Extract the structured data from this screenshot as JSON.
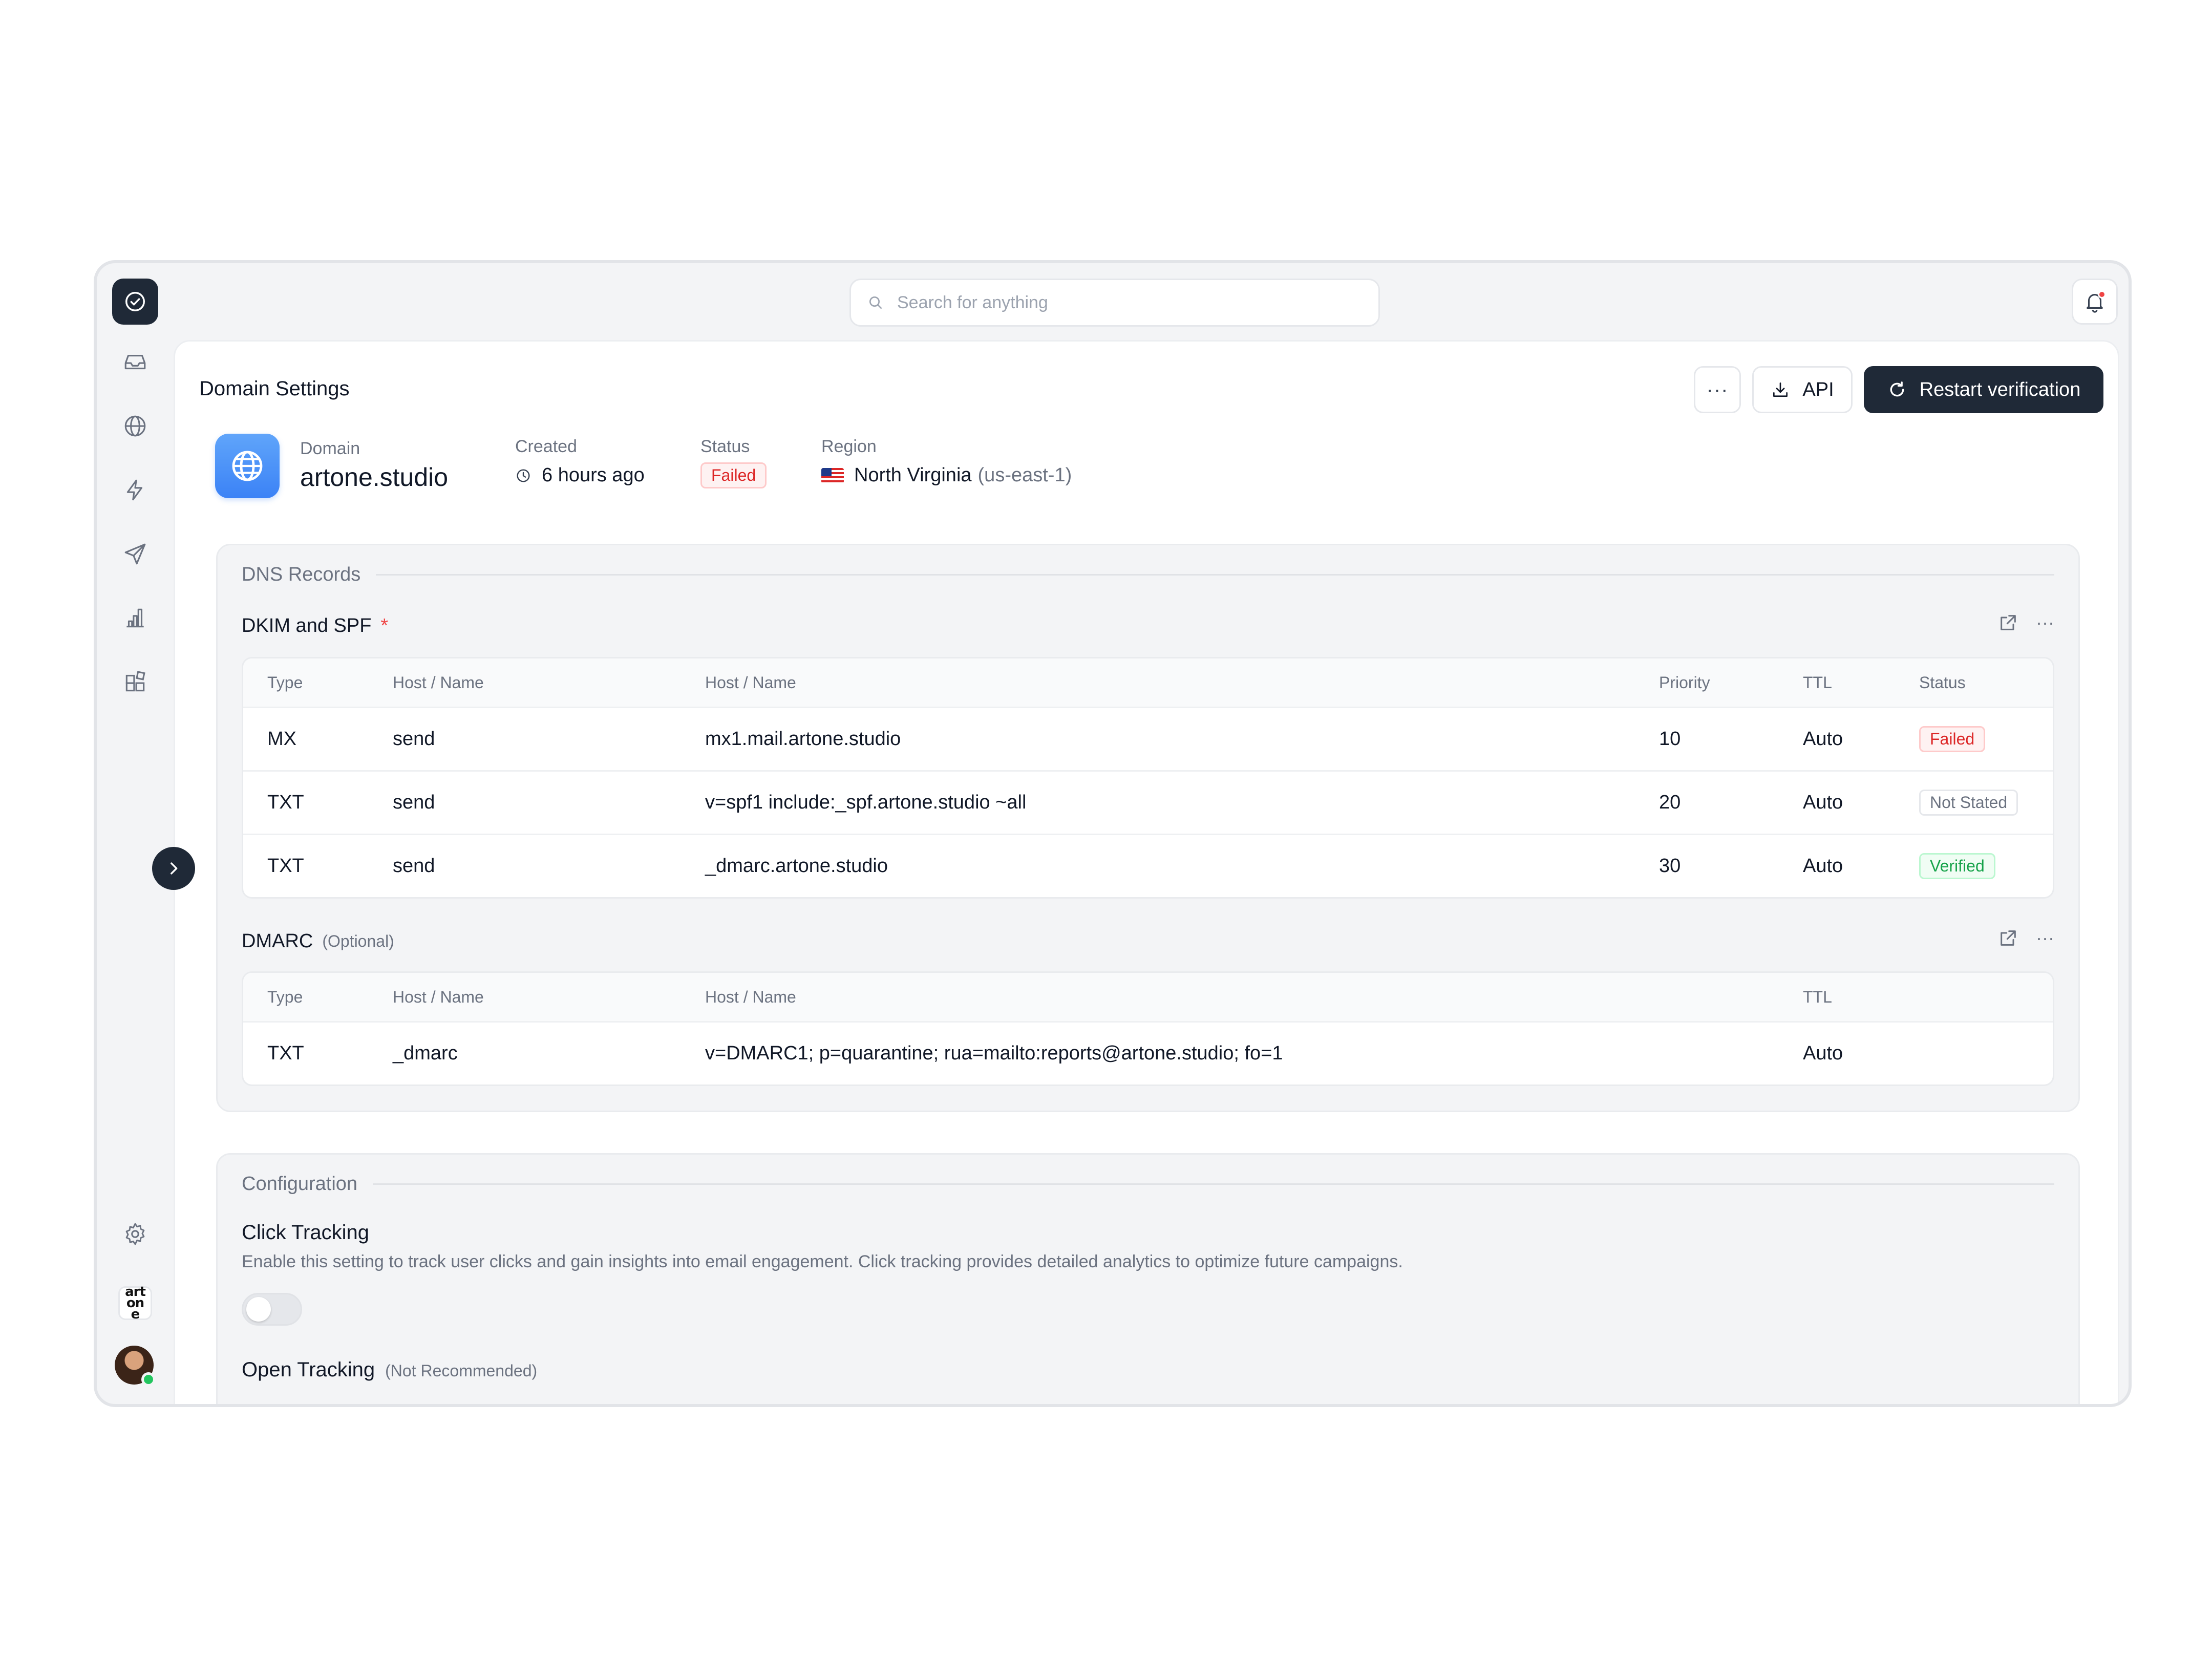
{
  "search": {
    "placeholder": "Search for anything"
  },
  "sidebar": {
    "items": [
      {
        "name": "inbox-icon"
      },
      {
        "name": "globe-icon"
      },
      {
        "name": "bolt-icon"
      },
      {
        "name": "send-icon"
      },
      {
        "name": "chart-icon"
      },
      {
        "name": "widgets-icon"
      }
    ],
    "settings_icon": "gear-icon",
    "brand_badge": "art one"
  },
  "header": {
    "title": "Domain Settings",
    "more_label": "···",
    "api_label": "API",
    "restart_label": "Restart verification"
  },
  "domain": {
    "label": "Domain",
    "name": "artone.studio",
    "created_label": "Created",
    "created_value": "6 hours ago",
    "status_label": "Status",
    "status_value": "Failed",
    "region_label": "Region",
    "region_name": "North Virginia",
    "region_code": "(us-east-1)"
  },
  "dns": {
    "section_title": "DNS Records",
    "dkim": {
      "title": "DKIM and SPF",
      "required_mark": "*",
      "columns": [
        "Type",
        "Host / Name",
        "Host / Name",
        "Priority",
        "TTL",
        "Status"
      ],
      "rows": [
        {
          "type": "MX",
          "host": "send",
          "value": "mx1.mail.artone.studio",
          "priority": "10",
          "ttl": "Auto",
          "status": "Failed"
        },
        {
          "type": "TXT",
          "host": "send",
          "value": "v=spf1 include:_spf.artone.studio ~all",
          "priority": "20",
          "ttl": "Auto",
          "status": "Not Stated"
        },
        {
          "type": "TXT",
          "host": "send",
          "value": "_dmarc.artone.studio",
          "priority": "30",
          "ttl": "Auto",
          "status": "Verified"
        }
      ]
    },
    "dmarc": {
      "title": "DMARC",
      "optional": "(Optional)",
      "columns": [
        "Type",
        "Host / Name",
        "Host / Name",
        "TTL"
      ],
      "rows": [
        {
          "type": "TXT",
          "host": "_dmarc",
          "value": "v=DMARC1; p=quarantine; rua=mailto:reports@artone.studio; fo=1",
          "ttl": "Auto"
        }
      ]
    },
    "more_label": "···"
  },
  "config": {
    "section_title": "Configuration",
    "click_tracking": {
      "title": "Click Tracking",
      "description": "Enable this setting to track user clicks and gain insights into email engagement. Click tracking provides detailed analytics to optimize future campaigns.",
      "enabled": false
    },
    "open_tracking": {
      "title": "Open Tracking",
      "note": "(Not Recommended)"
    }
  },
  "colors": {
    "accent_dark": "#1f2937",
    "failed": "#dc2626",
    "verified": "#16a34a",
    "domain_icon": "#3b82f6"
  }
}
